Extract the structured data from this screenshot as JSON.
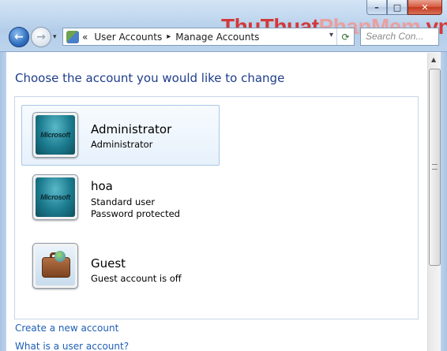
{
  "window": {
    "minimize_glyph": "–",
    "maximize_glyph": "□",
    "close_glyph": "✕"
  },
  "watermark": {
    "part1": "ThuThuat",
    "part2": "PhanMem",
    "part3": ".vn"
  },
  "navigation": {
    "back_icon": "arrow-left-icon",
    "forward_icon": "arrow-right-icon",
    "back_glyph": "←",
    "forward_glyph": "→",
    "dropdown_glyph": "▾"
  },
  "address": {
    "overflow": "«",
    "crumbs": [
      "User Accounts",
      "Manage Accounts"
    ],
    "separator": "▸",
    "dropdown_glyph": "▾",
    "refresh_glyph": "⟳"
  },
  "search": {
    "placeholder": "Search Con..."
  },
  "main": {
    "heading": "Choose the account you would like to change",
    "accounts": [
      {
        "name": "Administrator",
        "lines": [
          "Administrator"
        ],
        "picture": "microsoft-tile",
        "logo": "Microsoft",
        "selected": true
      },
      {
        "name": "hoa",
        "lines": [
          "Standard user",
          "Password protected"
        ],
        "picture": "microsoft-tile",
        "logo": "Microsoft",
        "selected": false
      },
      {
        "name": "Guest",
        "lines": [
          "Guest account is off"
        ],
        "picture": "briefcase-tile",
        "selected": false
      }
    ],
    "links": {
      "create": "Create a new account",
      "what_is": "What is a user account?"
    }
  },
  "scrollbar": {
    "up_glyph": "▲",
    "down_glyph": "▼"
  },
  "colors": {
    "heading": "#1e3d8a",
    "link": "#1e5fb4",
    "selection_border": "#a9c7e8",
    "watermark_red": "#d23a3a"
  }
}
